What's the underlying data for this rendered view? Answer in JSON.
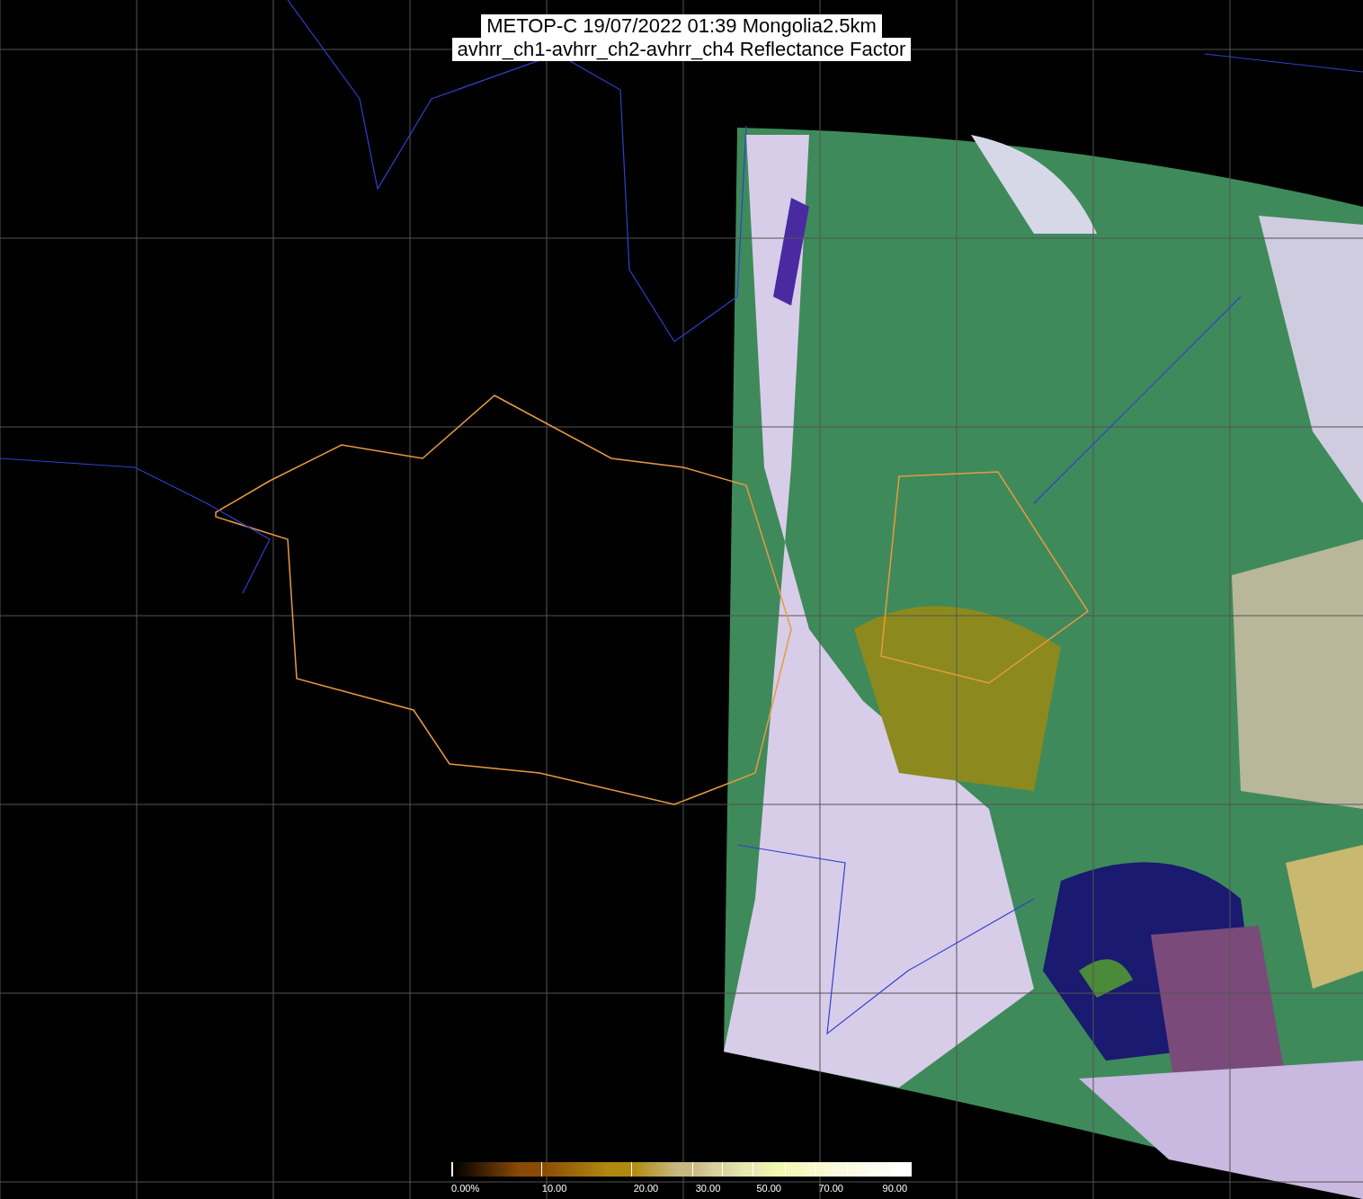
{
  "title_lines": [
    "METOP-C 19/07/2022 01:39 Mongolia2.5km",
    "avhrr_ch1-avhrr_ch2-avhrr_ch4 Reflectance Factor"
  ],
  "colorbar": {
    "segments": [
      {
        "color": "#8a4a05",
        "label": "0.00%"
      },
      {
        "color": "#b08a10",
        "label": "10.00"
      },
      {
        "color": "#c8b880",
        "label": "20.00"
      },
      {
        "color": "#d8d2a0",
        "label": "30.00"
      },
      {
        "color": "#e6e8b0"
      },
      {
        "color": "#f0f8b0",
        "label": "50.00"
      },
      {
        "color": "#f8f8c8"
      },
      {
        "color": "#fafae0",
        "label": "70.00"
      },
      {
        "color": "#fcfcf0"
      },
      {
        "color": "#ffffff",
        "label": "90.00"
      }
    ]
  }
}
